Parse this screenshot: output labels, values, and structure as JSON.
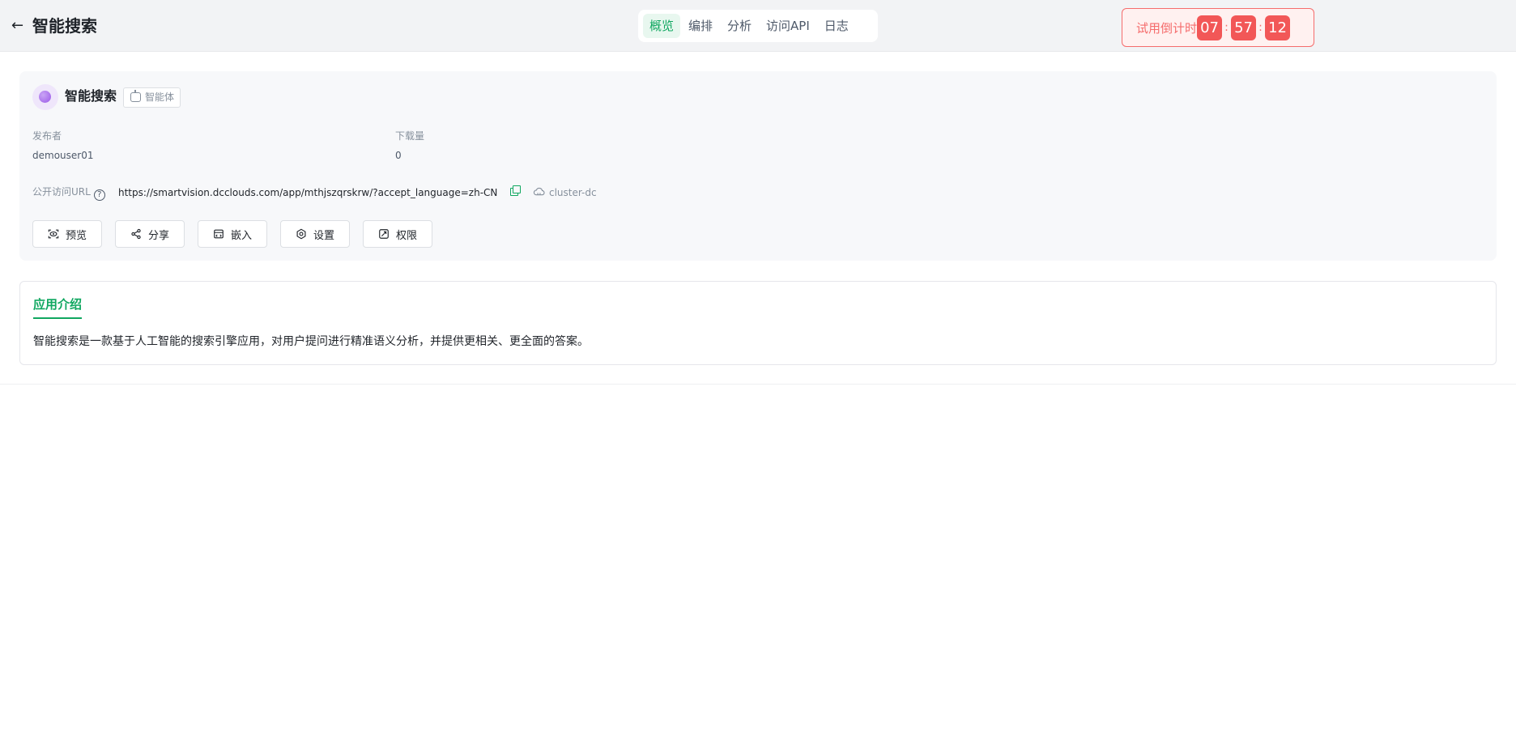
{
  "header": {
    "back_icon": "arrow-left-icon",
    "title": "智能搜索",
    "tabs": [
      {
        "label": "概览",
        "active": true
      },
      {
        "label": "编排",
        "active": false
      },
      {
        "label": "分析",
        "active": false
      },
      {
        "label": "访问API",
        "active": false
      },
      {
        "label": "日志",
        "active": false
      }
    ],
    "trial": {
      "label": "试用倒计时",
      "hours": "07",
      "minutes": "57",
      "seconds": "12",
      "sep": ":",
      "color": "#f25757"
    }
  },
  "app": {
    "name": "智能搜索",
    "tag": "智能体",
    "publisher_label": "发布者",
    "publisher": "demouser01",
    "downloads_label": "下载量",
    "downloads": "0",
    "url_label": "公开访问URL",
    "help_icon": "?",
    "url": "https://smartvision.dcclouds.com/app/mthjszqrskrw/?accept_language=zh-CN",
    "cluster": "cluster-dc",
    "actions": [
      {
        "label": "预览",
        "icon": "preview-icon"
      },
      {
        "label": "分享",
        "icon": "share-icon"
      },
      {
        "label": "嵌入",
        "icon": "embed-icon"
      },
      {
        "label": "设置",
        "icon": "gear-icon"
      },
      {
        "label": "权限",
        "icon": "permission-icon"
      }
    ]
  },
  "intro": {
    "tab": "应用介绍",
    "text": "智能搜索是一款基于人工智能的搜索引擎应用，对用户提问进行精准语义分析，并提供更相关、更全面的答案。"
  },
  "colors": {
    "accent": "#10a760",
    "warning": "#f56c6c"
  }
}
